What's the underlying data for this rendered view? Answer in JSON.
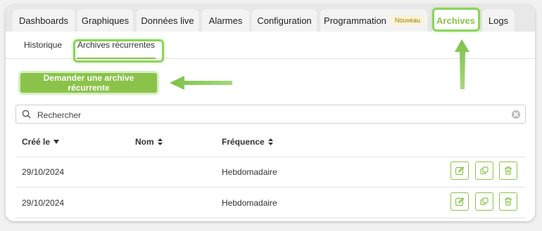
{
  "tabs": [
    {
      "label": "Dashboards"
    },
    {
      "label": "Graphiques"
    },
    {
      "label": "Données live"
    },
    {
      "label": "Alarmes"
    },
    {
      "label": "Configuration"
    },
    {
      "label": "Programmation",
      "badge": "Nouveau"
    },
    {
      "label": "Archives",
      "active": true
    },
    {
      "label": "Logs"
    }
  ],
  "subtabs": [
    {
      "label": "Historique"
    },
    {
      "label": "Archives récurrentes",
      "active": true
    }
  ],
  "request_button": "Demander une archive récurrente",
  "search": {
    "placeholder": "Rechercher"
  },
  "table": {
    "headers": {
      "created": "Créé le",
      "name": "Nom",
      "frequency": "Fréquence"
    },
    "rows": [
      {
        "created": "29/10/2024",
        "name": "",
        "frequency": "Hebdomadaire"
      },
      {
        "created": "29/10/2024",
        "name": "",
        "frequency": "Hebdomadaire"
      }
    ]
  },
  "colors": {
    "accent": "#8bc34a",
    "badge_bg": "#fbf3d3"
  },
  "icons": [
    "search-icon",
    "clear-icon",
    "sort-desc-icon",
    "sort-icon",
    "edit-icon",
    "duplicate-icon",
    "trash-icon"
  ]
}
